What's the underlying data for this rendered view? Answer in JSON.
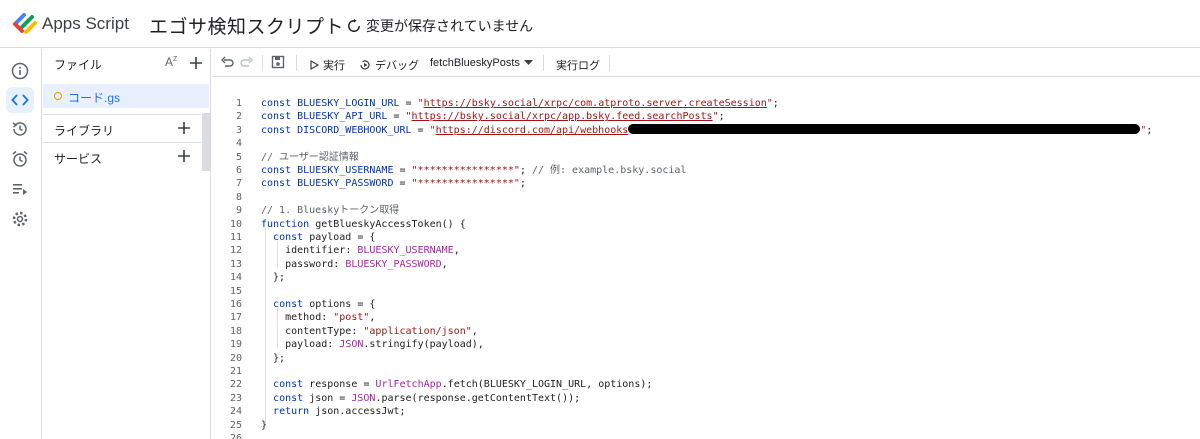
{
  "header": {
    "app_name": "Apps Script",
    "project_title": "エゴサ検知スクリプト",
    "save_status": "変更が保存されていません"
  },
  "rail": {
    "items": [
      {
        "icon": "info-icon",
        "active": false
      },
      {
        "icon": "code-icon",
        "active": true
      },
      {
        "icon": "history-icon",
        "active": false
      },
      {
        "icon": "alarm-icon",
        "active": false
      },
      {
        "icon": "executions-icon",
        "active": false
      },
      {
        "icon": "settings-icon",
        "active": false
      }
    ]
  },
  "files": {
    "title": "ファイル",
    "sort_label": "A-Z",
    "file_name": "コード.gs",
    "libraries_label": "ライブラリ",
    "services_label": "サービス"
  },
  "toolbar": {
    "run_label": "実行",
    "debug_label": "デバッグ",
    "function_name": "fetchBlueskyPosts",
    "log_label": "実行ログ"
  },
  "editor": {
    "lines": [
      {
        "n": "1",
        "html": "<span class=\"kw\">const</span> <span class=\"var\">BLUESKY_LOGIN_URL</span> = <span class=\"strq\">\"</span><span class=\"url\">https://bsky.social/xrpc/com.atproto.server.createSession</span><span class=\"strq\">\"</span>;"
      },
      {
        "n": "2",
        "html": "<span class=\"kw\">const</span> <span class=\"var\">BLUESKY_API_URL</span> = <span class=\"strq\">\"</span><span class=\"url\">https://bsky.social/xrpc/app.bsky.feed.searchPosts</span><span class=\"strq\">\"</span>;"
      },
      {
        "n": "3",
        "html": "<span class=\"kw\">const</span> <span class=\"var\">DISCORD_WEBHOOK_URL</span> = <span class=\"strq\">\"</span><span class=\"url\">https://discord.com/api/webhooks</span><span class=\"redact\"></span><span class=\"strq\">\"</span>;"
      },
      {
        "n": "4",
        "html": ""
      },
      {
        "n": "5",
        "html": "<span class=\"cmt\">// ユーザー認証情報</span>"
      },
      {
        "n": "6",
        "html": "<span class=\"kw\">const</span> <span class=\"var\">BLUESKY_USERNAME</span> = <span class=\"str\">\"****************\"</span>; <span class=\"cmt\">// 例: example.bsky.social</span>"
      },
      {
        "n": "7",
        "html": "<span class=\"kw\">const</span> <span class=\"var\">BLUESKY_PASSWORD</span> = <span class=\"str\">\"****************\"</span>;"
      },
      {
        "n": "8",
        "html": ""
      },
      {
        "n": "9",
        "html": "<span class=\"cmt\">// 1. Blueskyトークン取得</span>"
      },
      {
        "n": "10",
        "html": "<span class=\"kw\">function</span> <span class=\"plain\">getBlueskyAccessToken</span>() {"
      },
      {
        "n": "11",
        "html": "  <span class=\"kw\">const</span> <span class=\"plain\">payload</span> = {"
      },
      {
        "n": "12",
        "html": "    <span class=\"plain\">identifier</span>: <span class=\"const\">BLUESKY_USERNAME</span>,"
      },
      {
        "n": "13",
        "html": "    <span class=\"plain\">password</span>: <span class=\"const\">BLUESKY_PASSWORD</span>,"
      },
      {
        "n": "14",
        "html": "  };"
      },
      {
        "n": "15",
        "html": ""
      },
      {
        "n": "16",
        "html": "  <span class=\"kw\">const</span> <span class=\"plain\">options</span> = {"
      },
      {
        "n": "17",
        "html": "    <span class=\"plain\">method</span>: <span class=\"str\">\"post\"</span>,"
      },
      {
        "n": "18",
        "html": "    <span class=\"plain\">contentType</span>: <span class=\"str\">\"application/json\"</span>,"
      },
      {
        "n": "19",
        "html": "    <span class=\"plain\">payload</span>: <span class=\"cls\">JSON</span>.stringify(payload),"
      },
      {
        "n": "20",
        "html": "  };"
      },
      {
        "n": "21",
        "html": ""
      },
      {
        "n": "22",
        "html": "  <span class=\"kw\">const</span> <span class=\"plain\">response</span> = <span class=\"cls\">UrlFetchApp</span>.fetch(BLUESKY_LOGIN_URL, options);"
      },
      {
        "n": "23",
        "html": "  <span class=\"kw\">const</span> <span class=\"plain\">json</span> = <span class=\"cls\">JSON</span>.parse(response.getContentText());"
      },
      {
        "n": "24",
        "html": "  <span class=\"kw\">return</span> json.accessJwt;"
      },
      {
        "n": "25",
        "html": "}"
      },
      {
        "n": "26",
        "html": ""
      }
    ]
  },
  "colors": {
    "accent": "#1a73e8",
    "active_bg": "#e8f0fe",
    "border": "#dadce0",
    "file_dot": "#f29900"
  }
}
